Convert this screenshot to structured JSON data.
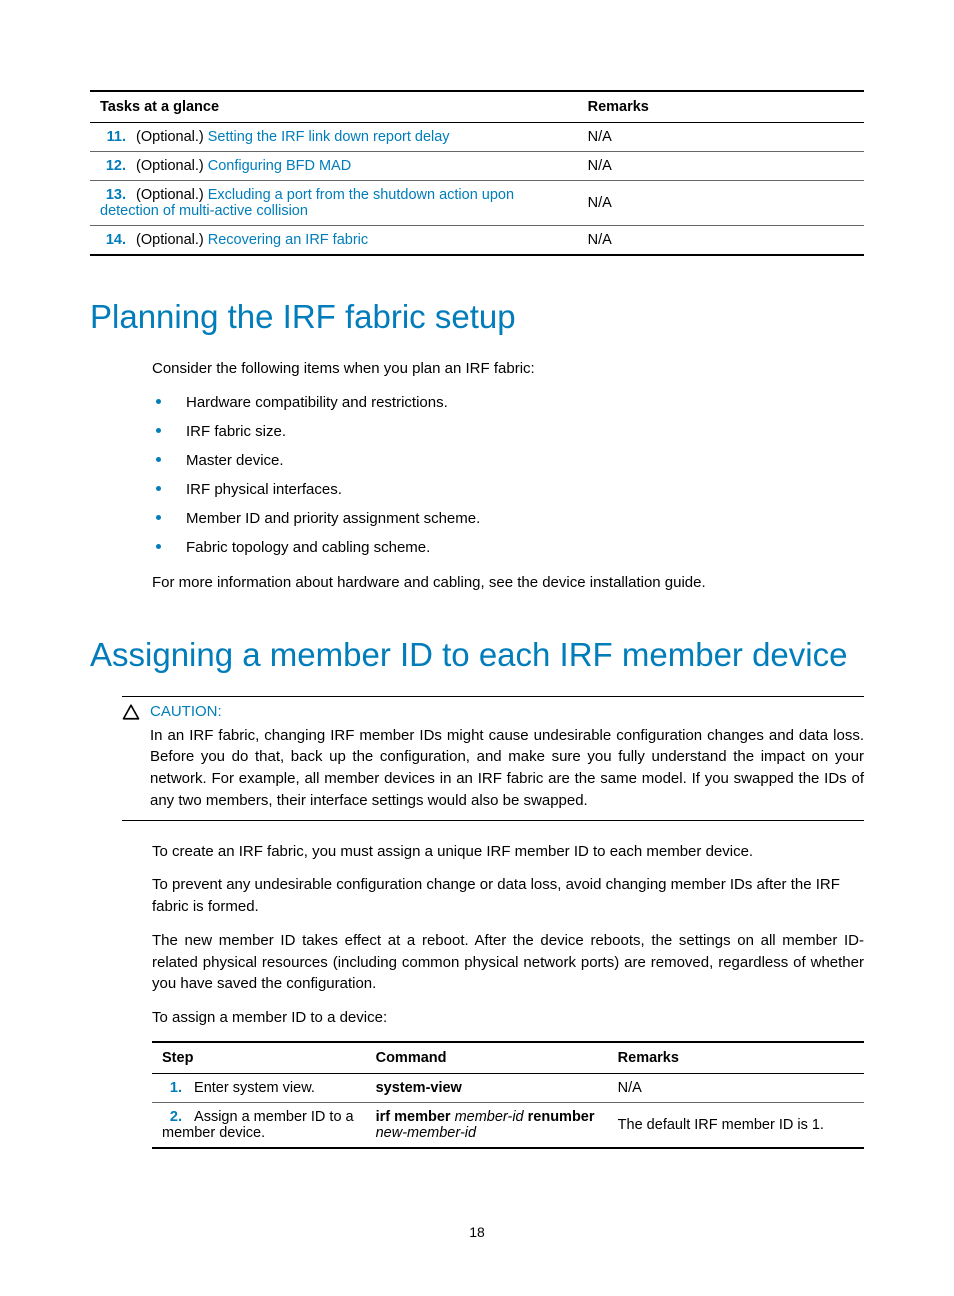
{
  "tasksTable": {
    "headers": {
      "tasks": "Tasks at a glance",
      "remarks": "Remarks"
    },
    "rows": [
      {
        "num": "11.",
        "optional": "(Optional.) ",
        "link": "Setting the IRF link down report delay",
        "linkSuffix": "",
        "remarks": "N/A"
      },
      {
        "num": "12.",
        "optional": "(Optional.) ",
        "link": "Configuring BFD MAD",
        "linkSuffix": "",
        "remarks": "N/A"
      },
      {
        "num": "13.",
        "optional": "(Optional.) ",
        "link": "Excluding a port from the shutdown action upon detection of multi-active collision",
        "linkSuffix": "",
        "remarks": "N/A"
      },
      {
        "num": "14.",
        "optional": "(Optional.) ",
        "link": "Recovering an IRF fabric",
        "linkSuffix": "",
        "remarks": "N/A"
      }
    ]
  },
  "planning": {
    "heading": "Planning the IRF fabric setup",
    "intro": "Consider the following items when you plan an IRF fabric:",
    "bullets": [
      "Hardware compatibility and restrictions.",
      "IRF fabric size.",
      "Master device.",
      "IRF physical interfaces.",
      "Member ID and priority assignment scheme.",
      "Fabric topology and cabling scheme."
    ],
    "closing": "For more information about hardware and cabling, see the device installation guide."
  },
  "assigning": {
    "heading": "Assigning a member ID to each IRF member device",
    "caution": {
      "label": "CAUTION:",
      "text": "In an IRF fabric, changing IRF member IDs might cause undesirable configuration changes and data loss. Before you do that, back up the configuration, and make sure you fully understand the impact on your network. For example, all member devices in an IRF fabric are the same model. If you swapped the IDs of any two members, their interface settings would also be swapped."
    },
    "p1": "To create an IRF fabric, you must assign a unique IRF member ID to each member device.",
    "p2": "To prevent any undesirable configuration change or data loss, avoid changing member IDs after the IRF fabric is formed.",
    "p3": "The new member ID takes effect at a reboot. After the device reboots, the settings on all member ID-related physical resources (including common physical network ports) are removed, regardless of whether you have saved the configuration.",
    "p4": "To assign a member ID to a device:",
    "stepsHeaders": {
      "step": "Step",
      "command": "Command",
      "remarks": "Remarks"
    },
    "steps": [
      {
        "num": "1.",
        "desc": "Enter system view.",
        "cmdBold1": "system-view",
        "cmdItal1": "",
        "cmdBold2": "",
        "cmdItal2": "",
        "remarks": "N/A"
      },
      {
        "num": "2.",
        "desc": "Assign a member ID to a member device.",
        "cmdBold1": "irf member",
        "cmdItal1": " member-id ",
        "cmdBold2": "renumber",
        "cmdItal2": "new-member-id",
        "remarks": "The default IRF member ID is 1."
      }
    ]
  },
  "pageNumber": "18"
}
